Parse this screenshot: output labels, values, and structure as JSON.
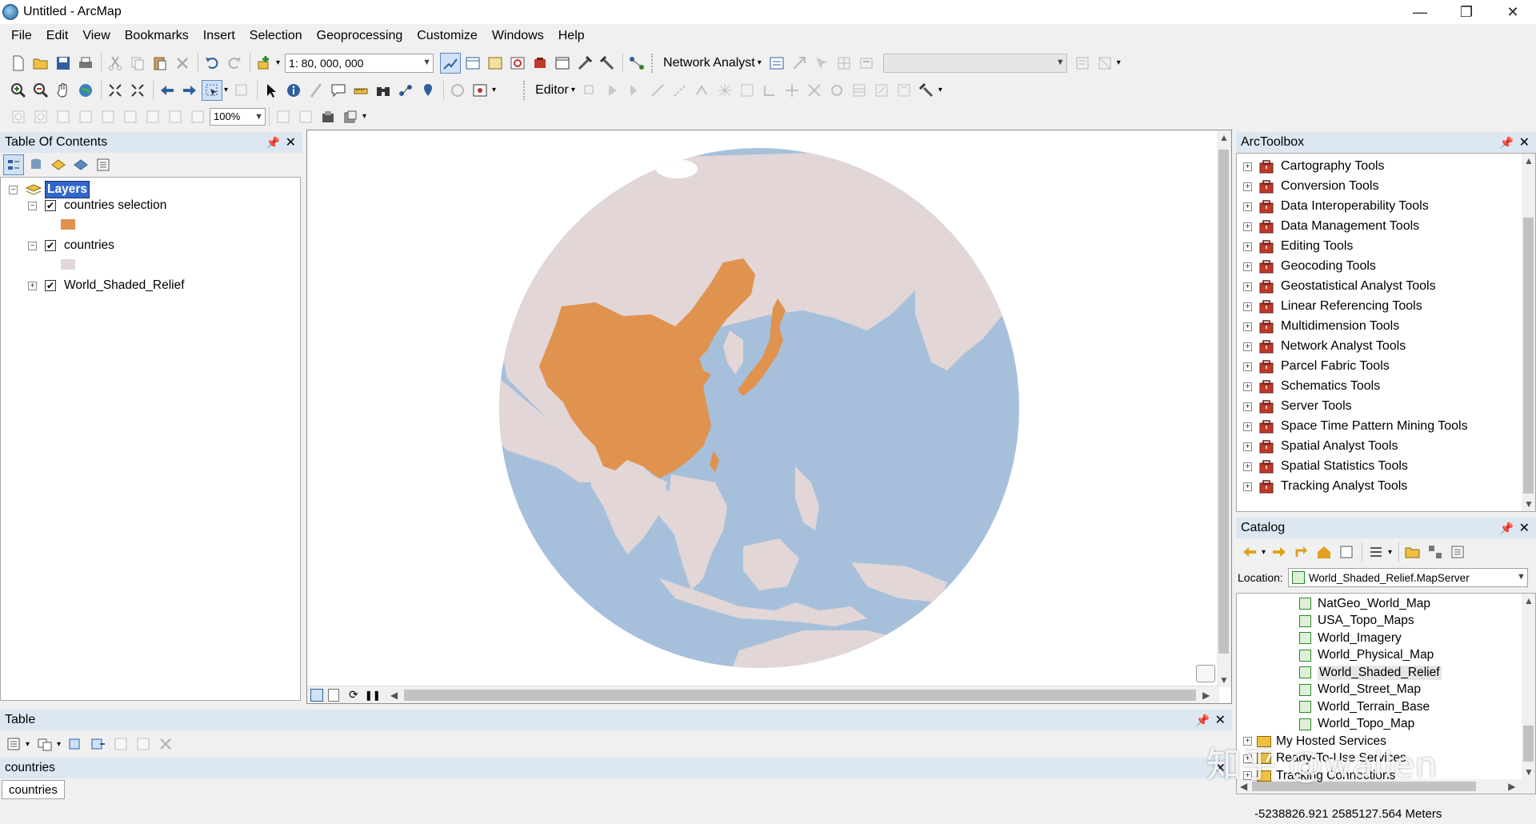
{
  "window": {
    "title": "Untitled - ArcMap",
    "minimize": "—",
    "restore": "❐",
    "close": "✕"
  },
  "menu": [
    "File",
    "Edit",
    "View",
    "Bookmarks",
    "Insert",
    "Selection",
    "Geoprocessing",
    "Customize",
    "Windows",
    "Help"
  ],
  "toolbar": {
    "scale": "1: 80, 000, 000",
    "network_analyst": "Network Analyst",
    "editor": "Editor",
    "zoom_percent": "100%"
  },
  "toc": {
    "title": "Table Of Contents",
    "root": "Layers",
    "layers": [
      {
        "name": "countries selection",
        "checked": true,
        "swatch": "#e0924f"
      },
      {
        "name": "countries",
        "checked": true,
        "swatch": "#e2d6d6"
      },
      {
        "name": "World_Shaded_Relief",
        "checked": true
      }
    ]
  },
  "arctoolbox": {
    "title": "ArcToolbox",
    "tools": [
      "Cartography Tools",
      "Conversion Tools",
      "Data Interoperability Tools",
      "Data Management Tools",
      "Editing Tools",
      "Geocoding Tools",
      "Geostatistical Analyst Tools",
      "Linear Referencing Tools",
      "Multidimension Tools",
      "Network Analyst Tools",
      "Parcel Fabric Tools",
      "Schematics Tools",
      "Server Tools",
      "Space Time Pattern Mining Tools",
      "Spatial Analyst Tools",
      "Spatial Statistics Tools",
      "Tracking Analyst Tools"
    ]
  },
  "catalog": {
    "title": "Catalog",
    "location_label": "Location:",
    "location_value": "World_Shaded_Relief.MapServer",
    "items": [
      {
        "name": "NatGeo_World_Map",
        "selected": false
      },
      {
        "name": "USA_Topo_Maps",
        "selected": false
      },
      {
        "name": "World_Imagery",
        "selected": false
      },
      {
        "name": "World_Physical_Map",
        "selected": false
      },
      {
        "name": "World_Shaded_Relief",
        "selected": true
      },
      {
        "name": "World_Street_Map",
        "selected": false
      },
      {
        "name": "World_Terrain_Base",
        "selected": false
      },
      {
        "name": "World_Topo_Map",
        "selected": false
      }
    ],
    "folders": [
      "My Hosted Services",
      "Ready-To-Use Services",
      "Tracking Connections"
    ]
  },
  "table": {
    "title": "Table",
    "layer_name": "countries",
    "tab": "countries"
  },
  "status": {
    "coords": "-5238826.921  2585127.564 Meters"
  },
  "watermark": "知乎 @wallen",
  "colors": {
    "ocean": "#a6c0dc",
    "land": "#e2d6d6",
    "selection": "#e0924f",
    "panel_header": "#dde7f2",
    "toolbox_red": "#c0392b"
  }
}
